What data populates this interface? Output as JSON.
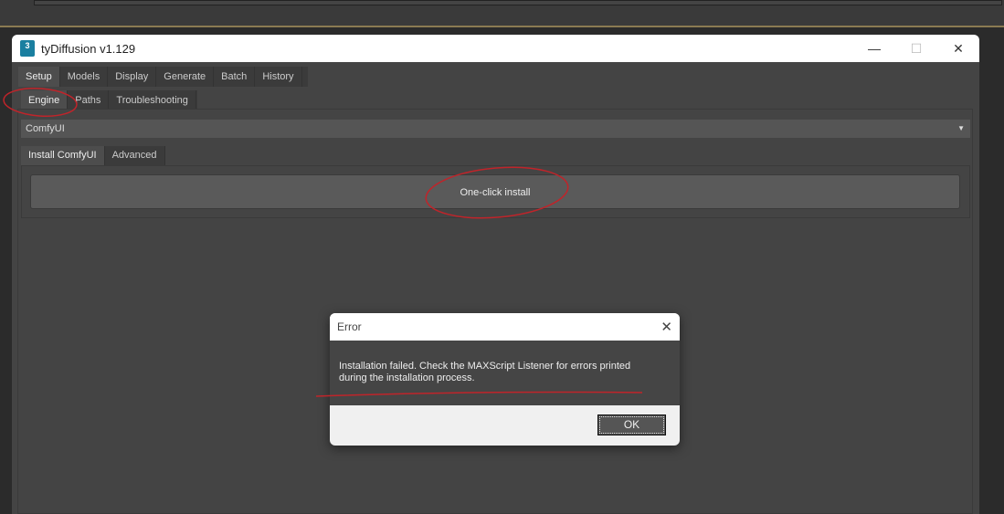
{
  "window": {
    "title": "tyDiffusion v1.129",
    "icon_label": "3"
  },
  "main_tabs": [
    {
      "label": "Setup"
    },
    {
      "label": "Models"
    },
    {
      "label": "Display"
    },
    {
      "label": "Generate"
    },
    {
      "label": "Batch"
    },
    {
      "label": "History"
    }
  ],
  "sub_tabs": [
    {
      "label": "Engine"
    },
    {
      "label": "Paths"
    },
    {
      "label": "Troubleshooting"
    }
  ],
  "engine_select": {
    "value": "ComfyUI"
  },
  "engine_tabs": [
    {
      "label": "Install ComfyUI"
    },
    {
      "label": "Advanced"
    }
  ],
  "install_button": "One-click install",
  "dialog": {
    "title": "Error",
    "message_line1": "Installation failed. Check the MAXScript Listener for errors printed",
    "message_line2": "during the installation process.",
    "ok_label": "OK"
  }
}
